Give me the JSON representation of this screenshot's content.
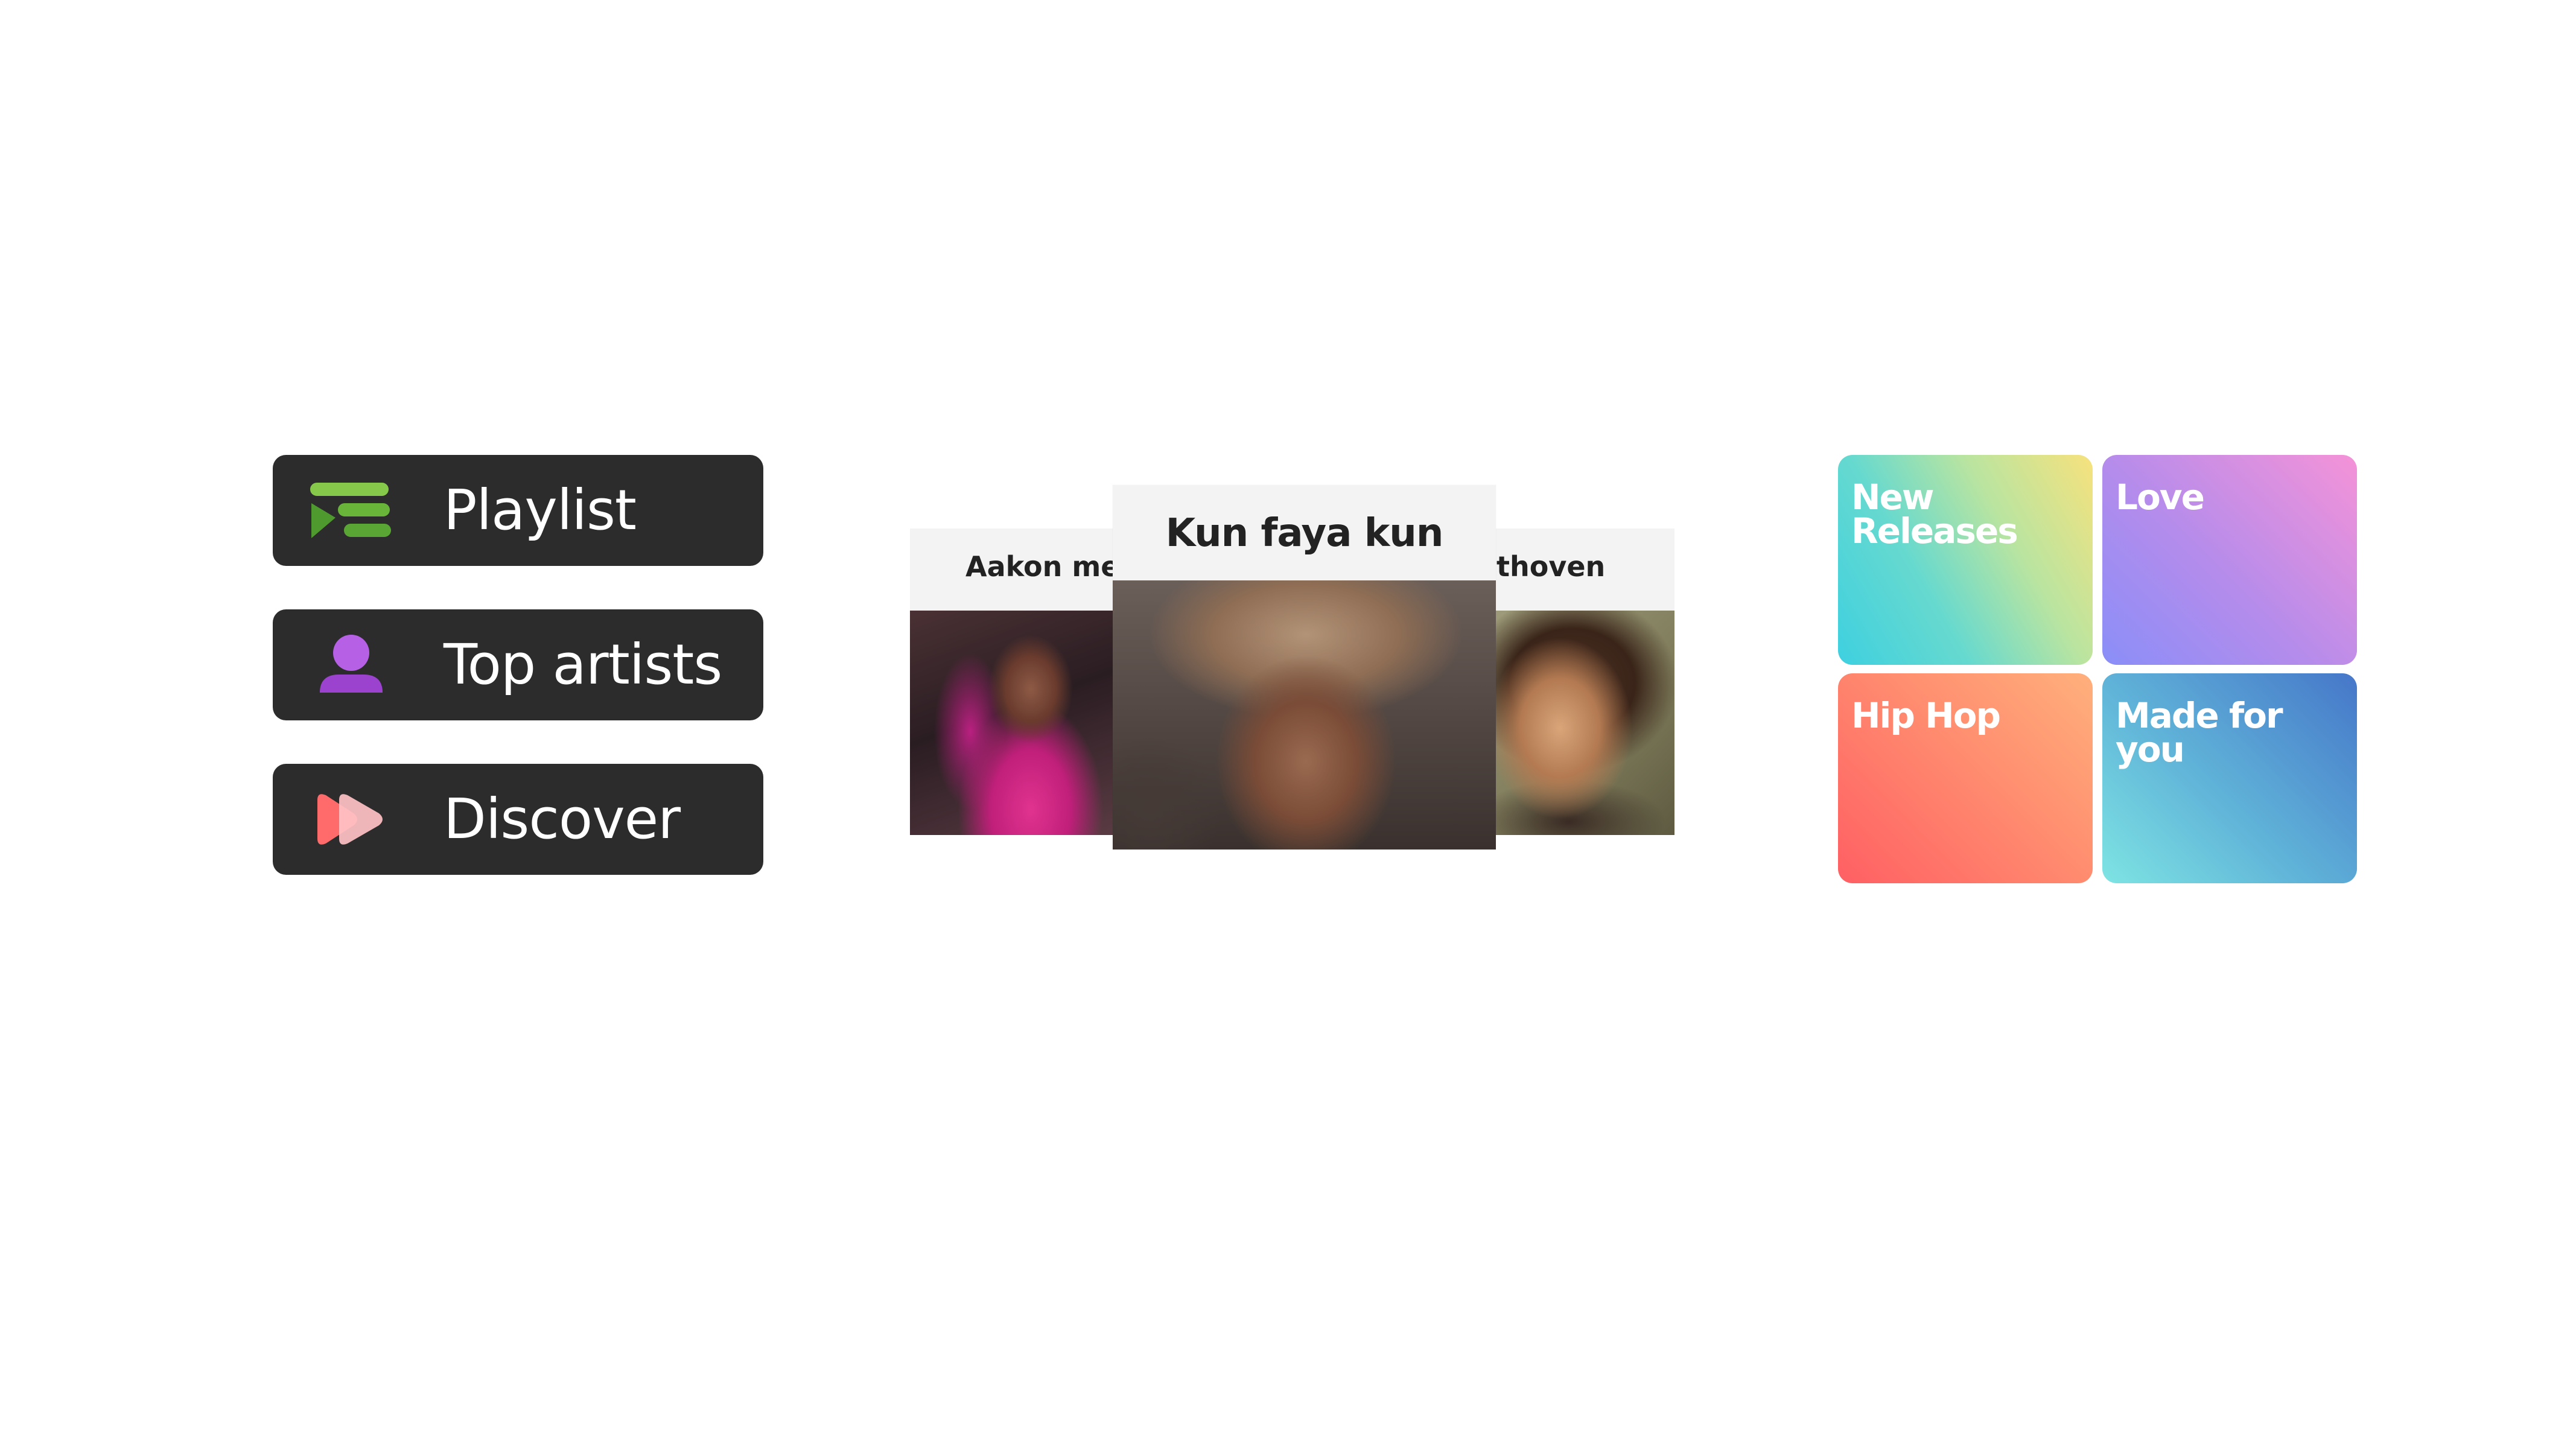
{
  "nav": {
    "items": [
      {
        "label": "Playlist",
        "icon": "playlist-icon"
      },
      {
        "label": "Top artists",
        "icon": "person-icon"
      },
      {
        "label": "Discover",
        "icon": "discover-icon"
      }
    ]
  },
  "carousel": {
    "left_card": {
      "title": "Aakon mei"
    },
    "center_card": {
      "title": "Kun faya kun"
    },
    "right_card": {
      "title": "thoven"
    }
  },
  "tiles": [
    {
      "label": "New\nReleases"
    },
    {
      "label": "Love"
    },
    {
      "label": "Hip Hop"
    },
    {
      "label": "Made for\nyou"
    }
  ],
  "colors": {
    "nav_bg": "#2c2c2c",
    "playlist_icon": "#7dc243",
    "person_icon": "#a84fd9",
    "discover_icon": "#ff6f6f"
  }
}
